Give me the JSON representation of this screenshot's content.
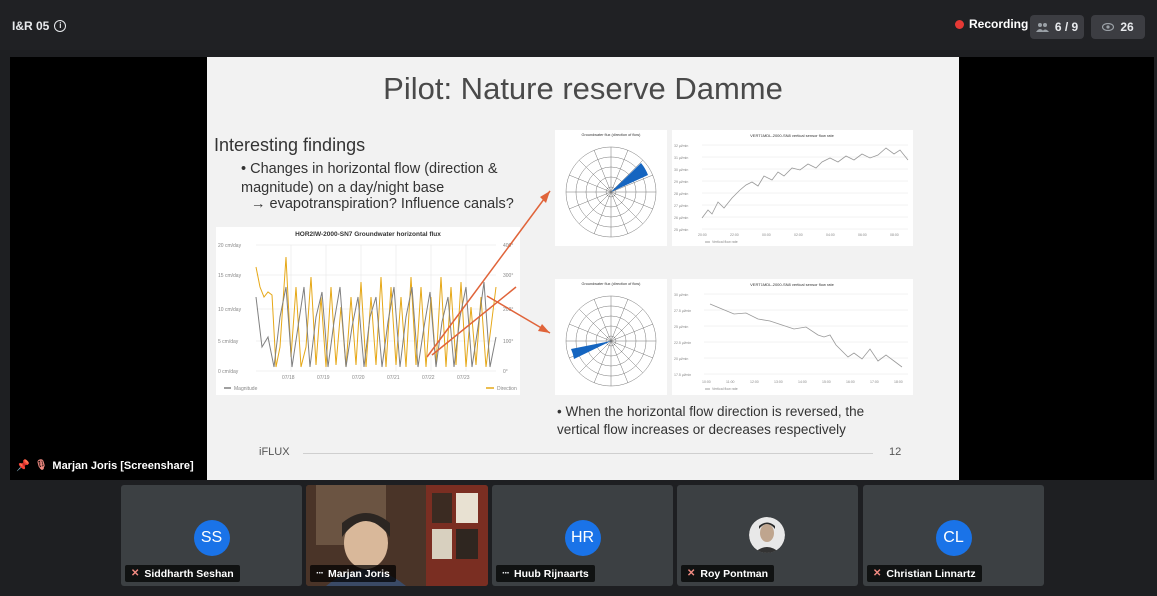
{
  "meeting": {
    "title": "I&R 05"
  },
  "header": {
    "recording_label": "Recording",
    "participants": "6 / 9",
    "viewers": "26"
  },
  "slide": {
    "title": "Pilot: Nature reserve Damme",
    "findings_heading": "Interesting findings",
    "bullet_1": "• Changes in horizontal flow (direction & magnitude) on a day/night base",
    "arrow_line": "→ evapotranspiration? Influence canals?",
    "bottom_bullet": "• When the horizontal flow direction is reversed, the vertical flow increases or decreases respectively",
    "footer_logo": "iFLUX",
    "page_number": "12",
    "main_chart": {
      "title": "HOR2IW-2000-SN7 Groundwater horizontal flux",
      "y_left_ticks": [
        "20 cm/day",
        "15 cm/day",
        "10 cm/day",
        "5 cm/day",
        "0 cm/day"
      ],
      "y_right_ticks": [
        "400°",
        "300°",
        "200°",
        "100°",
        "0°"
      ],
      "x_ticks": [
        "07/18",
        "07/19",
        "07/20",
        "07/21",
        "07/22",
        "07/23"
      ],
      "legend_left": "Magnitude",
      "legend_right": "Direction"
    },
    "rose_top_title": "Groundwater flux (direction of flow)",
    "rose_bottom_title": "Groundwater flux (direction of flow)",
    "line_top": {
      "title": "VERT1MDL-2000-SN8 vertical sensor flow rate",
      "y_ticks": [
        "32 µl/min",
        "31 µl/min",
        "30 µl/min",
        "29 µl/min",
        "28 µl/min",
        "27 µl/min",
        "26 µl/min",
        "25 µl/min"
      ],
      "x_ticks": [
        "20:00",
        "22:00",
        "00:00",
        "02:00",
        "04:00",
        "06:00",
        "08:00"
      ],
      "legend": "Vertical flow rate"
    },
    "line_bottom": {
      "title": "VERT1MDL-2000-SN8 vertical sensor flow rate",
      "y_ticks": [
        "30 µl/min",
        "27.5 µl/min",
        "25 µl/min",
        "22.5 µl/min",
        "20 µl/min",
        "17.5 µl/min"
      ],
      "x_ticks": [
        "10:00",
        "11:00",
        "12:00",
        "13:00",
        "14:00",
        "15:00",
        "16:00",
        "17:00",
        "18:00"
      ],
      "legend": "Vertical flow rate"
    }
  },
  "presenter": {
    "label": "Marjan Joris [Screenshare]"
  },
  "participants": [
    {
      "initials": "SS",
      "name": "Siddharth Seshan"
    },
    {
      "initials": "",
      "name": "Marjan Joris"
    },
    {
      "initials": "HR",
      "name": "Huub Rijnaarts"
    },
    {
      "initials": "",
      "name": "Roy Pontman"
    },
    {
      "initials": "CL",
      "name": "Christian Linnartz"
    }
  ],
  "colors": {
    "accent": "#1a73e8",
    "recording": "#e53935",
    "magnitude": "#808080",
    "direction": "#e6a817",
    "rose_wedge": "#1565c0",
    "arrow": "#e0643a"
  },
  "icons": {
    "info": "info-icon",
    "participants": "people-icon",
    "viewers": "eye-icon",
    "mute": "mic-off-icon",
    "pin": "pin-icon",
    "more": "more-icon"
  }
}
